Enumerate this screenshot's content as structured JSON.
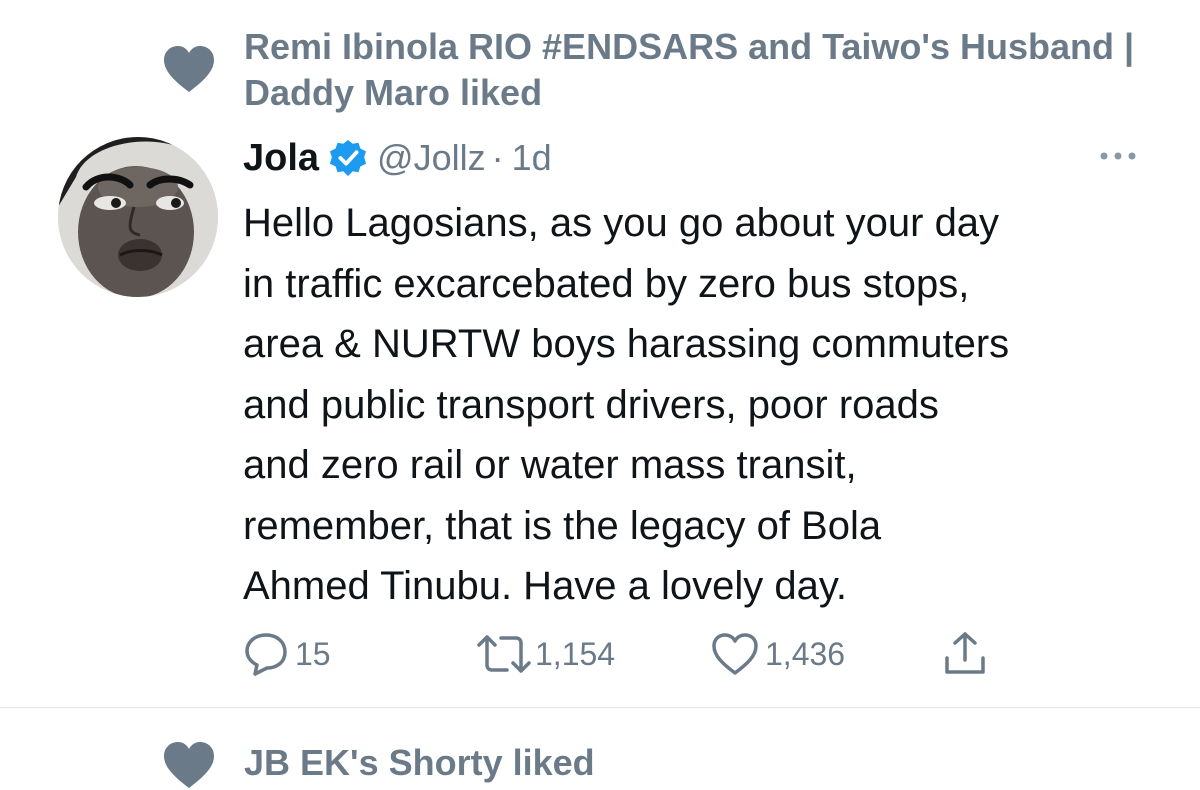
{
  "context": {
    "icon": "heart-icon",
    "text": "Remi Ibinola RIO #ENDSARS and Taiwo's Husband | Daddy Maro liked"
  },
  "tweet": {
    "display_name": "Jola",
    "verified_icon": "verified-badge-icon",
    "handle": "@Jollz",
    "separator": "·",
    "time": "1d",
    "more_icon": "more-dots-icon",
    "text_lines": [
      "Hello Lagosians, as you go about your day",
      "in traffic excarcebated by zero bus stops,",
      "area & NURTW boys harassing commuters",
      "and public transport drivers, poor roads",
      "and zero rail or water mass transit,",
      "remember, that is the legacy of Bola",
      "Ahmed Tinubu. Have a lovely day."
    ],
    "actions": {
      "reply": {
        "icon": "reply-icon",
        "count": "15"
      },
      "retweet": {
        "icon": "retweet-icon",
        "count": "1,154"
      },
      "like": {
        "icon": "like-icon",
        "count": "1,436"
      },
      "share": {
        "icon": "share-icon"
      }
    }
  },
  "next_item": {
    "icon": "heart-icon",
    "text": "JB EK's Shorty liked"
  },
  "colors": {
    "text": "#0f1419",
    "secondary": "#6b7a88",
    "verified": "#1d9bf0",
    "divider": "#e1e6ea"
  }
}
